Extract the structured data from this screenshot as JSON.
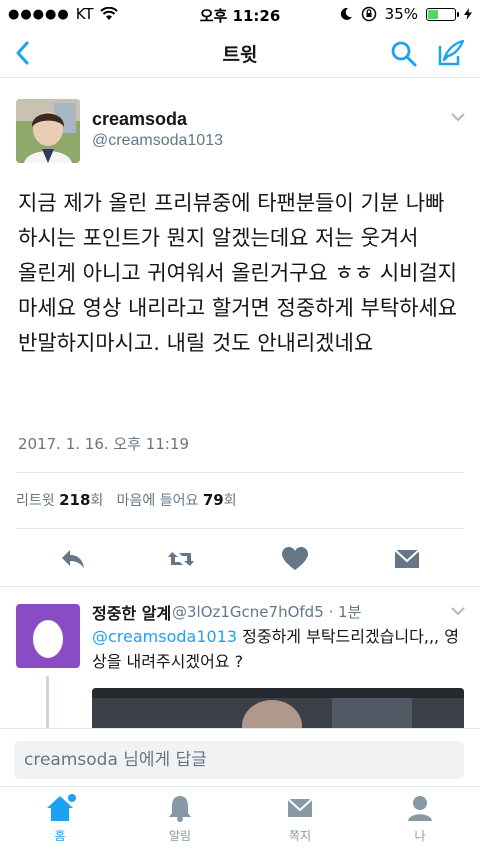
{
  "status_bar": {
    "carrier": "KT",
    "time": "오후 11:26",
    "battery_text": "35%",
    "battery_fill": 0.35
  },
  "nav": {
    "title": "트윗"
  },
  "tweet": {
    "name": "creamsoda",
    "handle": "@creamsoda1013",
    "text": "지금 제가 올린 프리뷰중에 타팬분들이 기분 나빠 하시는 포인트가 뭔지 알겠는데요 저는 웃겨서 올린게 아니고 귀여워서 올린거구요 ㅎㅎ 시비걸지 마세요 영상 내리라고 할거면 정중하게 부탁하세요 반말하지마시고. 내릴 것도 안내리겠네요",
    "timestamp": "2017. 1. 16. 오후 11:19",
    "retweet_label": "리트윗",
    "retweet_count": "218",
    "retweet_unit": "회",
    "like_label": "마음에 들어요",
    "like_count": "79",
    "like_unit": "회"
  },
  "reply": {
    "name": "정중한 알계",
    "handle_time": "@3lOz1Gcne7hOfd5 · 1분",
    "mention": "@creamsoda1013",
    "text": " 정중하게 부탁드리겠습니다,,, 영상을 내려주시겠어요 ?"
  },
  "reply_bar": {
    "placeholder": "creamsoda 님에게 답글"
  },
  "tabs": [
    {
      "label": "홈",
      "icon": "home-icon",
      "active": true
    },
    {
      "label": "알림",
      "icon": "bell-icon",
      "active": false
    },
    {
      "label": "쪽지",
      "icon": "envelope-icon",
      "active": false
    },
    {
      "label": "나",
      "icon": "person-icon",
      "active": false
    }
  ],
  "colors": {
    "accent": "#1da1f2",
    "text": "#14171a",
    "muted": "#657786"
  }
}
